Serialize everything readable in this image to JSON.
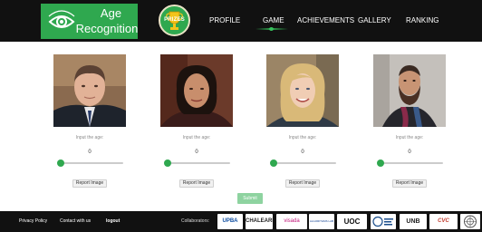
{
  "header": {
    "logo_line1": "Age",
    "logo_line2": "Recognition",
    "prizes_label": "PRIZES",
    "nav": [
      "PROFILE",
      "GAME",
      "ACHIEVEMENTS",
      "GALLERY",
      "RANKING"
    ],
    "active_nav": "GAME"
  },
  "cards": [
    {
      "prompt": "Input the age:",
      "age_value": "0",
      "slider_level": 0,
      "report_label": "Report Image"
    },
    {
      "prompt": "Input the age:",
      "age_value": "0",
      "slider_level": 0,
      "report_label": "Report Image"
    },
    {
      "prompt": "Input the age:",
      "age_value": "0",
      "slider_level": 0,
      "report_label": "Report Image"
    },
    {
      "prompt": "Input the age:",
      "age_value": "0",
      "slider_level": 0,
      "report_label": "Report Image"
    }
  ],
  "submit_label": "Submit",
  "footer": {
    "privacy": "Privacy Policy",
    "contact": "Contact with us",
    "logout": "logout",
    "collaborators_label": "Collaborators:",
    "collaborators": [
      "UPBA",
      "CHALEARN",
      "visada",
      "ALGORITHMS LAB",
      "UOC",
      "",
      "UNB",
      "CVC",
      ""
    ]
  },
  "colors": {
    "accent": "#2fa84f",
    "nav_bg": "#111111",
    "submit_bg": "#8ed3a0"
  }
}
